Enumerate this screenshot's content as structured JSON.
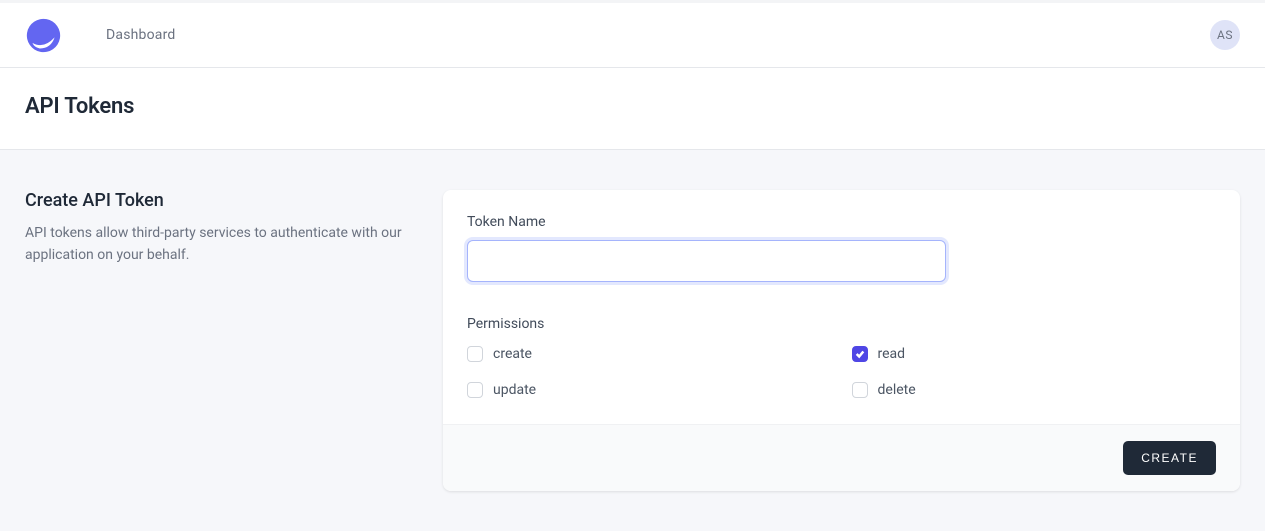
{
  "nav": {
    "link_dashboard": "Dashboard"
  },
  "user": {
    "initials": "AS"
  },
  "header": {
    "title": "API Tokens"
  },
  "section": {
    "title": "Create API Token",
    "description": "API tokens allow third-party services to authenticate with our application on your behalf."
  },
  "form": {
    "token_name_label": "Token Name",
    "token_name_value": "",
    "permissions_label": "Permissions",
    "permissions": [
      {
        "key": "create",
        "label": "create",
        "checked": false
      },
      {
        "key": "read",
        "label": "read",
        "checked": true
      },
      {
        "key": "update",
        "label": "update",
        "checked": false
      },
      {
        "key": "delete",
        "label": "delete",
        "checked": false
      }
    ],
    "submit_label": "CREATE"
  },
  "colors": {
    "accent": "#4f46e5",
    "dark": "#1f2937"
  }
}
